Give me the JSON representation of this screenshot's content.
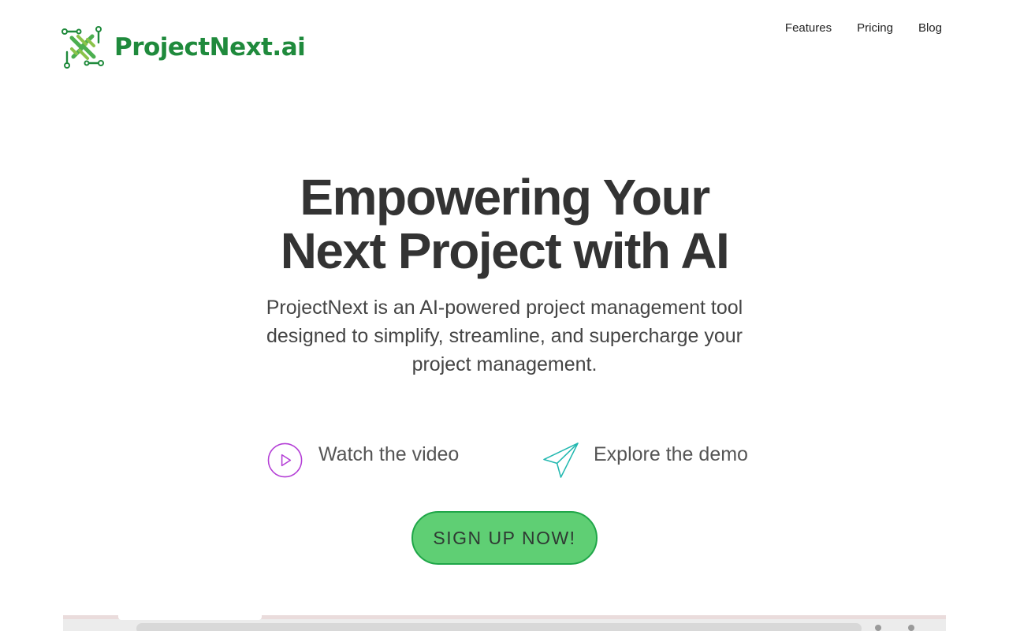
{
  "brand": {
    "name": "ProjectNext.ai",
    "primary_color": "#1f8a3c",
    "accent_color": "#5fcf74"
  },
  "nav": {
    "items": [
      {
        "label": "Features"
      },
      {
        "label": "Pricing"
      },
      {
        "label": "Blog"
      }
    ]
  },
  "hero": {
    "title_line1": "Empowering Your",
    "title_line2": "Next Project with AI",
    "subtitle": "ProjectNext is an AI-powered project management tool designed to simplify, streamline, and supercharge your project management."
  },
  "actions": {
    "video": {
      "label": "Watch the video",
      "icon": "play-circle-icon",
      "color": "#b43fd6"
    },
    "demo": {
      "label": "Explore the demo",
      "icon": "paper-plane-icon",
      "color": "#22b8b0"
    }
  },
  "cta": {
    "label": "SIGN UP NOW!"
  }
}
